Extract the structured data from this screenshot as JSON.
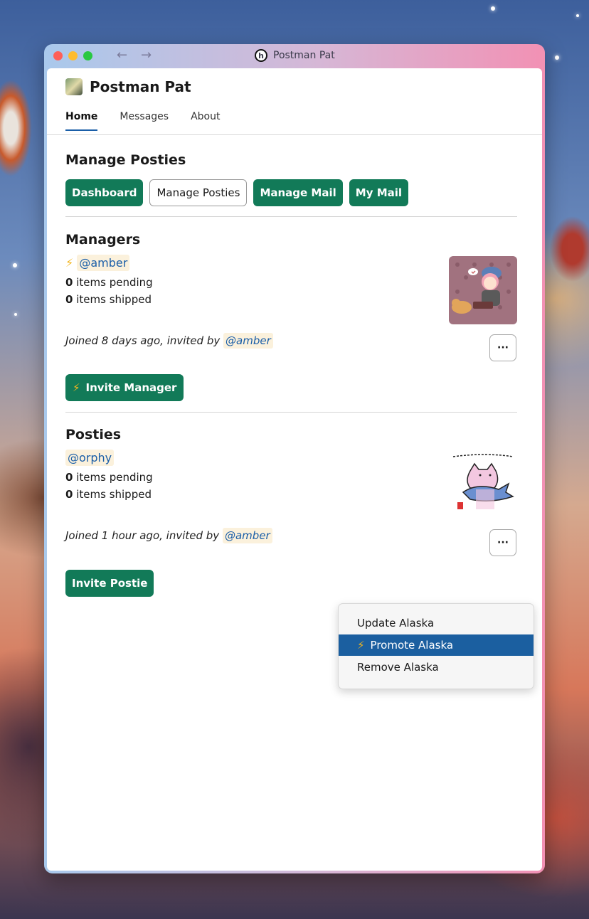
{
  "window": {
    "title": "Postman Pat",
    "back_icon": "←",
    "forward_icon": "→",
    "logo_letter": "h"
  },
  "app": {
    "name": "Postman Pat"
  },
  "tabs": [
    {
      "label": "Home"
    },
    {
      "label": "Messages"
    },
    {
      "label": "About"
    }
  ],
  "page": {
    "title": "Manage Posties",
    "buttons": [
      {
        "label": "Dashboard"
      },
      {
        "label": "Manage Posties"
      },
      {
        "label": "Manage Mail"
      },
      {
        "label": "My Mail"
      }
    ]
  },
  "managers": {
    "heading": "Managers",
    "bolt_icon": "⚡",
    "member": {
      "handle": "@amber",
      "pending_count": "0",
      "pending_label": "items pending",
      "shipped_count": "0",
      "shipped_label": "items shipped",
      "joined_text": "Joined 8 days ago, invited by",
      "invited_by": "@amber"
    },
    "more_label": "···",
    "invite_button": "Invite Manager"
  },
  "posties": {
    "heading": "Posties",
    "member": {
      "handle": "@orphy",
      "pending_count": "0",
      "pending_label": "items pending",
      "shipped_count": "0",
      "shipped_label": "items shipped",
      "joined_text": "Joined 1 hour ago, invited by",
      "invited_by": "@amber"
    },
    "more_label": "···",
    "invite_button": "Invite Postie"
  },
  "context_menu": {
    "items": [
      {
        "label": "Update Alaska"
      },
      {
        "label": "Promote Alaska",
        "icon": "⚡"
      },
      {
        "label": "Remove Alaska"
      }
    ]
  },
  "colors": {
    "primary_green": "#127a58",
    "accent_blue": "#1a5ea8",
    "menu_highlight": "#1b5fa0",
    "bolt": "#f2b51d"
  }
}
